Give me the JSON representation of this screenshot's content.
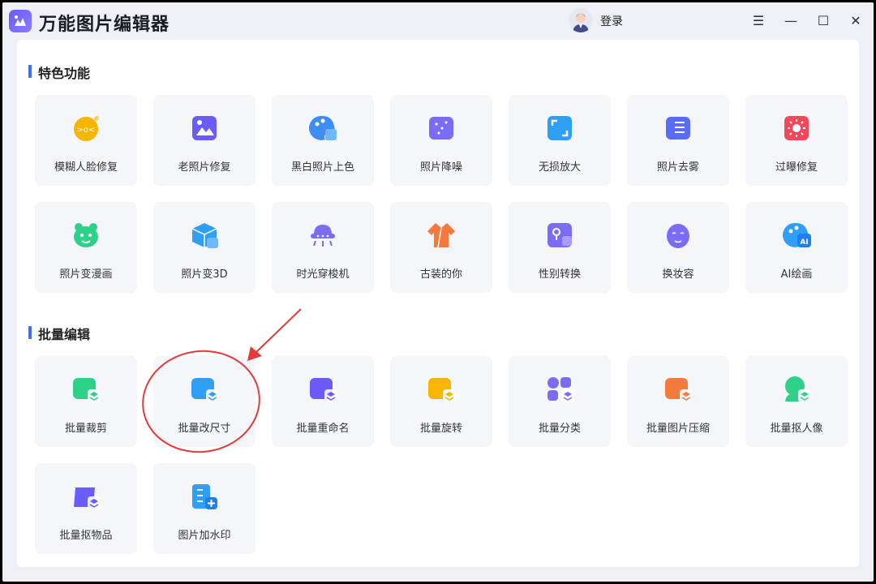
{
  "app": {
    "title": "万能图片编辑器",
    "login": "登录"
  },
  "window_controls": {
    "menu": "☰",
    "minimize": "—",
    "maximize": "☐",
    "close": "✕"
  },
  "sections": [
    {
      "title": "特色功能",
      "cards": [
        {
          "label": "模糊人脸修复",
          "icon": "blurry-face-icon",
          "color": "#f7b500"
        },
        {
          "label": "老照片修复",
          "icon": "old-photo-icon",
          "color": "#6a5cf6"
        },
        {
          "label": "黑白照片上色",
          "icon": "palette-photo-icon",
          "color": "#3f8cf5"
        },
        {
          "label": "照片降噪",
          "icon": "denoise-icon",
          "color": "#7b6cf6"
        },
        {
          "label": "无损放大",
          "icon": "expand-icon",
          "color": "#2f9ef5"
        },
        {
          "label": "照片去雾",
          "icon": "defog-icon",
          "color": "#5a6cf5"
        },
        {
          "label": "过曝修复",
          "icon": "overexposure-icon",
          "color": "#f5475a"
        },
        {
          "label": "照片变漫画",
          "icon": "cartoon-face-icon",
          "color": "#2fd18a"
        },
        {
          "label": "照片变3D",
          "icon": "cube-3d-icon",
          "color": "#2f9ef5"
        },
        {
          "label": "时光穿梭机",
          "icon": "ufo-icon",
          "color": "#7b6cf6"
        },
        {
          "label": "古装的你",
          "icon": "ancient-robe-icon",
          "color": "#f5793a"
        },
        {
          "label": "性别转换",
          "icon": "gender-swap-icon",
          "color": "#7b6cf6"
        },
        {
          "label": "换妆容",
          "icon": "makeup-face-icon",
          "color": "#7b6cf6"
        },
        {
          "label": "AI绘画",
          "icon": "ai-palette-icon",
          "color": "#2f9ef5"
        }
      ]
    },
    {
      "title": "批量编辑",
      "cards": [
        {
          "label": "批量裁剪",
          "icon": "batch-crop-icon",
          "color": "#2fd18a"
        },
        {
          "label": "批量改尺寸",
          "icon": "batch-resize-icon",
          "color": "#2f9ef5"
        },
        {
          "label": "批量重命名",
          "icon": "batch-rename-icon",
          "color": "#6a5cf6"
        },
        {
          "label": "批量旋转",
          "icon": "batch-rotate-icon",
          "color": "#f7b500"
        },
        {
          "label": "批量分类",
          "icon": "batch-classify-icon",
          "color": "#7b6cf6"
        },
        {
          "label": "批量图片压缩",
          "icon": "batch-compress-icon",
          "color": "#f5793a"
        },
        {
          "label": "批量抠人像",
          "icon": "batch-portrait-cutout-icon",
          "color": "#2fd18a"
        },
        {
          "label": "批量抠物品",
          "icon": "batch-object-cutout-icon",
          "color": "#6a5cf6"
        },
        {
          "label": "图片加水印",
          "icon": "watermark-icon",
          "color": "#2f9ef5"
        }
      ]
    }
  ],
  "annotation": {
    "color": "#e33b3b"
  }
}
